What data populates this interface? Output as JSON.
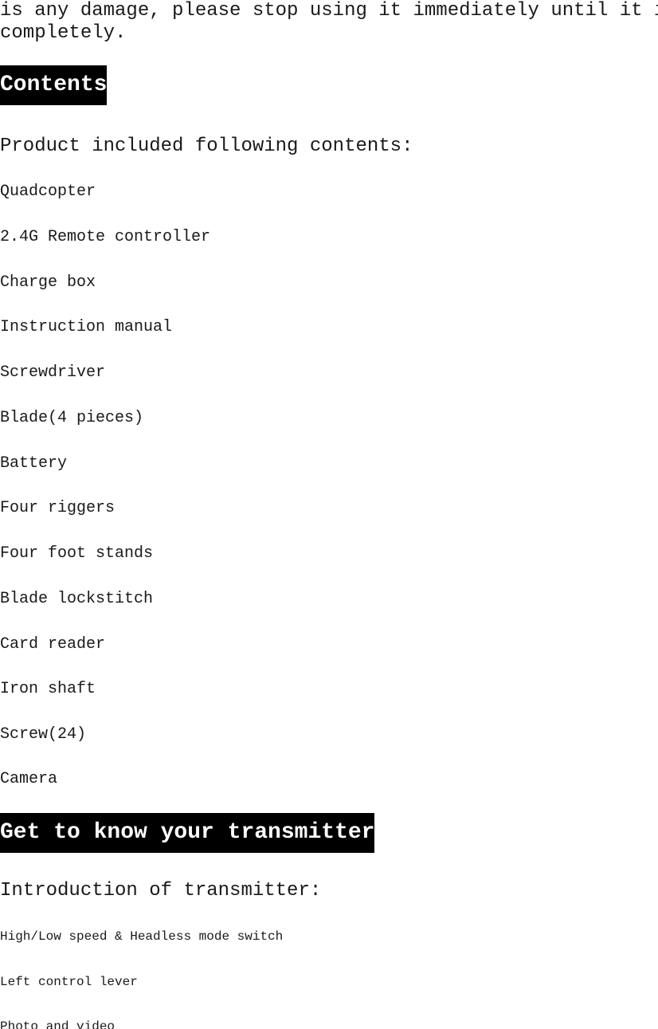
{
  "document": {
    "page_background": "#ffffff",
    "text_color": "#1a1a1a",
    "heading_background": "#000000",
    "heading_text_color": "#ffffff",
    "intro_paragraph": {
      "line1": "is any damage, please stop using it immediately until it is repaired",
      "line2": "completely."
    },
    "sections": [
      {
        "heading": "Contents",
        "lead": "Product included following contents:",
        "items": [
          "Quadcopter",
          "2.4G Remote controller",
          "Charge box",
          "Instruction manual",
          "Screwdriver",
          "Blade(4 pieces)",
          "Battery",
          "Four riggers",
          "Four foot stands",
          "Blade lockstitch",
          "Card reader",
          "Iron shaft",
          "Screw(24)",
          "Camera"
        ]
      },
      {
        "heading": "Get to know your transmitter",
        "lead": "Introduction of transmitter:",
        "items": [
          "High/Low speed & Headless mode switch",
          "Left control lever",
          "Photo and video"
        ]
      }
    ]
  }
}
